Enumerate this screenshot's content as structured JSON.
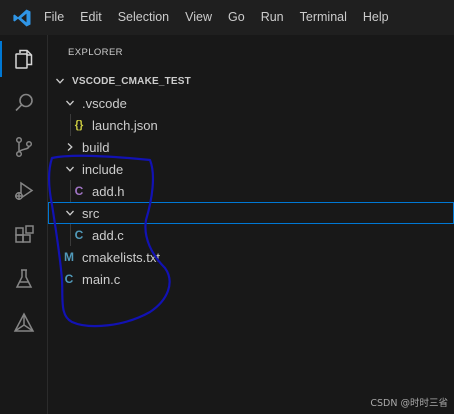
{
  "menu": {
    "items": [
      "File",
      "Edit",
      "Selection",
      "View",
      "Go",
      "Run",
      "Terminal",
      "Help"
    ]
  },
  "activity_bar": {
    "icons": [
      "explorer-icon",
      "search-icon",
      "source-control-icon",
      "run-debug-icon",
      "extensions-icon",
      "testing-icon",
      "cmake-icon"
    ]
  },
  "sidebar": {
    "title": "EXPLORER",
    "folder_name": "VSCODE_CMAKE_TEST",
    "tree": [
      {
        "label": ".vscode",
        "kind": "folder",
        "expanded": true
      },
      {
        "label": "launch.json",
        "kind": "json",
        "icon": "{}"
      },
      {
        "label": "build",
        "kind": "folder",
        "expanded": false
      },
      {
        "label": "include",
        "kind": "folder",
        "expanded": true
      },
      {
        "label": "add.h",
        "kind": "c-header",
        "icon": "C"
      },
      {
        "label": "src",
        "kind": "folder",
        "expanded": true
      },
      {
        "label": "add.c",
        "kind": "c-source",
        "icon": "C"
      },
      {
        "label": "cmakelists.txt",
        "kind": "markdown",
        "icon": "M"
      },
      {
        "label": "main.c",
        "kind": "c-source",
        "icon": "C"
      }
    ]
  },
  "colors": {
    "accent": "#0078d4",
    "json_icon": "#cbcb41",
    "c_header_icon": "#a074c4",
    "c_source_icon": "#519aba",
    "annotation": "#1212b3"
  },
  "watermark": "CSDN @时时三省"
}
